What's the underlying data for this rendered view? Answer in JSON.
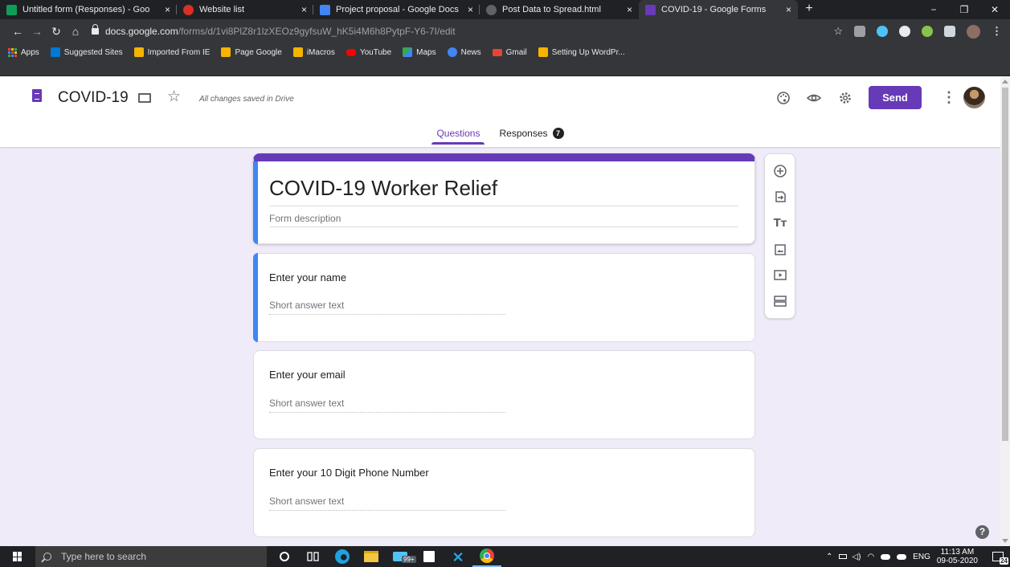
{
  "browser": {
    "tabs": [
      {
        "title": "Untitled form (Responses) - Goo",
        "favicon_color": "#0f9d58",
        "active": false
      },
      {
        "title": "Website list",
        "favicon_color": "#d93025",
        "active": false
      },
      {
        "title": "Project proposal - Google Docs",
        "favicon_color": "#4285f4",
        "active": false
      },
      {
        "title": "Post Data to Spread.html",
        "favicon_color": "#5f6368",
        "active": false
      },
      {
        "title": "COVID-19 - Google Forms",
        "favicon_color": "#673ab7",
        "active": true
      }
    ],
    "tab_close_symbol": "×",
    "new_tab_symbol": "+",
    "window_controls": [
      "−",
      "❐",
      "✕"
    ],
    "url_host": "docs.google.com",
    "url_path": "/forms/d/1vi8PlZ8r1lzXEOz9gyfsuW_hK5i4M6h8PytpF-Y6-7I/edit",
    "bookmarks": [
      {
        "label": "Apps",
        "icon": "apps-grid-icon"
      },
      {
        "label": "Suggested Sites",
        "icon": "bing-icon",
        "color": "#0078d4"
      },
      {
        "label": "Imported From IE",
        "icon": "folder-icon",
        "color": "#f4b400"
      },
      {
        "label": "Page Google",
        "icon": "folder-icon",
        "color": "#f4b400"
      },
      {
        "label": "iMacros",
        "icon": "folder-icon",
        "color": "#f4b400"
      },
      {
        "label": "YouTube",
        "icon": "youtube-icon",
        "color": "#ff0000"
      },
      {
        "label": "Maps",
        "icon": "maps-icon",
        "color": "#34a853"
      },
      {
        "label": "News",
        "icon": "news-icon",
        "color": "#4285f4"
      },
      {
        "label": "Gmail",
        "icon": "gmail-icon",
        "color": "#ea4335"
      },
      {
        "label": "Setting Up WordPr...",
        "icon": "wordpress-icon",
        "color": "#f4b400"
      }
    ]
  },
  "forms_header": {
    "title": "COVID-19",
    "saved_status": "All changes saved in Drive",
    "send_label": "Send",
    "tabs": [
      {
        "label": "Questions",
        "active": true
      },
      {
        "label": "Responses",
        "active": false,
        "badge": "7"
      }
    ],
    "accent_color": "#673ab7"
  },
  "form": {
    "title": "COVID-19 Worker Relief",
    "description_placeholder": "Form description",
    "questions": [
      {
        "title": "Enter your name",
        "answer_placeholder": "Short answer text"
      },
      {
        "title": "Enter your email",
        "answer_placeholder": "Short answer text"
      },
      {
        "title": "Enter your 10 Digit Phone Number",
        "answer_placeholder": "Short answer text"
      }
    ]
  },
  "side_toolbar": [
    "add-question-icon",
    "import-questions-icon",
    "add-title-icon",
    "add-image-icon",
    "add-video-icon",
    "add-section-icon"
  ],
  "help_symbol": "?",
  "taskbar": {
    "search_placeholder": "Type here to search",
    "store_badge": "99+",
    "tray_language": "ENG",
    "time": "11:13 AM",
    "date": "09-05-2020",
    "notification_count": "24"
  }
}
